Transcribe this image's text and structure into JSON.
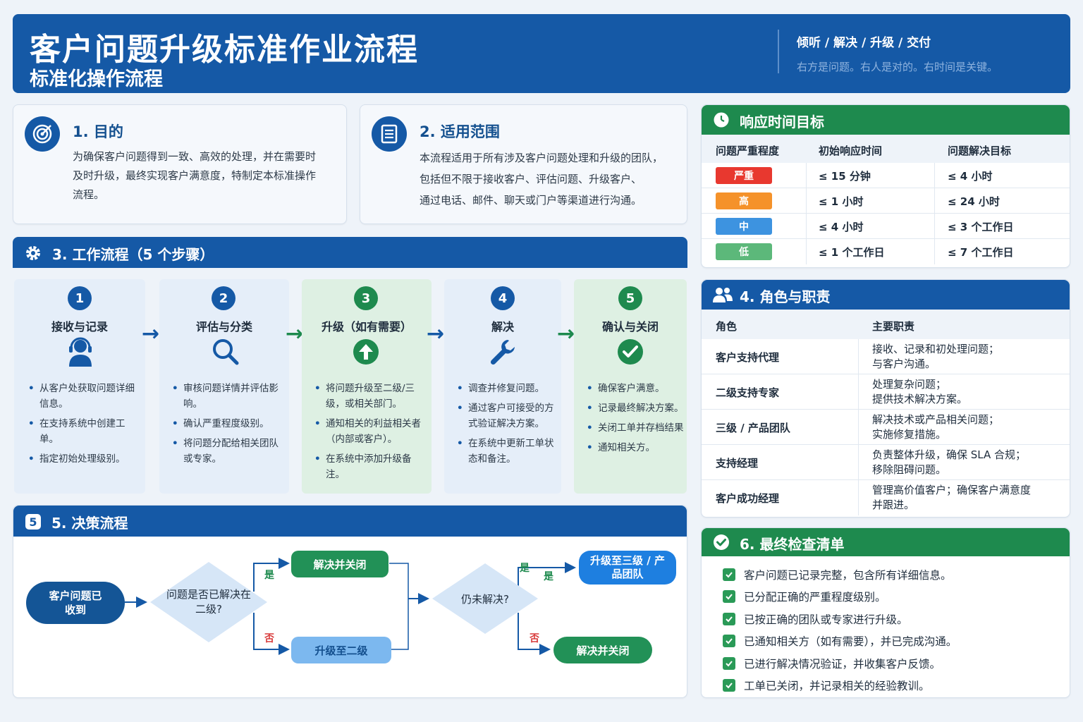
{
  "header": {
    "title": "客户问题升级标准作业流程",
    "subtitle": "标准化操作流程",
    "tagline": "倾听 / 解决 / 升级 / 交付",
    "note": "右方是问题。右人是对的。右时间是关键。"
  },
  "purpose": {
    "title": "1. 目的",
    "lines": [
      "为确保客户问题得到一致、高效的处理，并在需要时",
      "及时升级，最终实现客户满意度，特制定本标准操作",
      "流程。"
    ]
  },
  "scope": {
    "title": "2. 适用范围",
    "lines": [
      "本流程适用于所有涉及客户问题处理和升级的团队，",
      "包括但不限于接收客户、评估问题、升级客户、",
      "通过电话、邮件、聊天或门户等渠道进行沟通。"
    ]
  },
  "workflow": {
    "title": "3. 工作流程（5 个步骤）",
    "steps": [
      {
        "num": "1",
        "name": "接收与记录",
        "items": [
          "从客户处获取问题详细信息。",
          "在支持系统中创建工单。",
          "指定初始处理级别。"
        ]
      },
      {
        "num": "2",
        "name": "评估与分类",
        "items": [
          "审核问题详情并评估影响。",
          "确认严重程度级别。",
          "将问题分配给相关团队或专家。"
        ]
      },
      {
        "num": "3",
        "name": "升级（如有需要）",
        "items": [
          "将问题升级至二级/三级，或相关部门。",
          "通知相关的利益相关者（内部或客户）。",
          "在系统中添加升级备注。"
        ]
      },
      {
        "num": "4",
        "name": "解决",
        "items": [
          "调查并修复问题。",
          "通过客户可接受的方式验证解决方案。",
          "在系统中更新工单状态和备注。"
        ]
      },
      {
        "num": "5",
        "name": "确认与关闭",
        "items": [
          "确保客户满意。",
          "记录最终解决方案。",
          "关闭工单并存档结果",
          "通知相关方。"
        ]
      }
    ]
  },
  "response": {
    "title": "响应时间目标",
    "headers": [
      "问题严重程度",
      "初始响应时间",
      "问题解决目标"
    ],
    "rows": [
      {
        "level": "严重",
        "color": "#e8382f",
        "initial": "≤ 15 分钟",
        "resolve": "≤ 4 小时"
      },
      {
        "level": "高",
        "color": "#f5922a",
        "initial": "≤ 1 小时",
        "resolve": "≤ 24 小时"
      },
      {
        "level": "中",
        "color": "#3d93e0",
        "initial": "≤ 4 小时",
        "resolve": "≤ 3 个工作日"
      },
      {
        "level": "低",
        "color": "#5cb87a",
        "initial": "≤ 1 个工作日",
        "resolve": "≤ 7 个工作日"
      }
    ]
  },
  "roles": {
    "title": "4. 角色与职责",
    "headers": [
      "角色",
      "主要职责"
    ],
    "rows": [
      {
        "role": "客户支持代理",
        "duty1": "接收、记录和初处理问题；",
        "duty2": "与客户沟通。"
      },
      {
        "role": "二级支持专家",
        "duty1": "处理复杂问题；",
        "duty2": "提供技术解决方案。"
      },
      {
        "role": "三级 / 产品团队",
        "duty1": "解决技术或产品相关问题；",
        "duty2": "实施修复措施。"
      },
      {
        "role": "支持经理",
        "duty1": "负责整体升级，确保 SLA 合规；",
        "duty2": "移除阻碍问题。"
      },
      {
        "role": "客户成功经理",
        "duty1": "管理高价值客户；确保客户满意度",
        "duty2": "并跟进。"
      }
    ]
  },
  "decision": {
    "title": "5. 决策流程",
    "received": "客户问题已收到",
    "q1": "问题是否已解决在二级?",
    "resolve1": "解决并关闭",
    "escalate2": "升级至二级",
    "q2": "仍未解决?",
    "escalate3": "升级至三级 / 产品团队",
    "resolve2": "解决并关闭",
    "yes": "是",
    "no": "否"
  },
  "checklist": {
    "title": "6. 最终检查清单",
    "items": [
      "客户问题已记录完整，包含所有详细信息。",
      "已分配正确的严重程度级别。",
      "已按正确的团队或专家进行升级。",
      "已通知相关方（如有需要），并已完成沟通。",
      "已进行解决情况验证，并收集客户反馈。",
      "工单已关闭，并记录相关的经验教训。"
    ]
  }
}
